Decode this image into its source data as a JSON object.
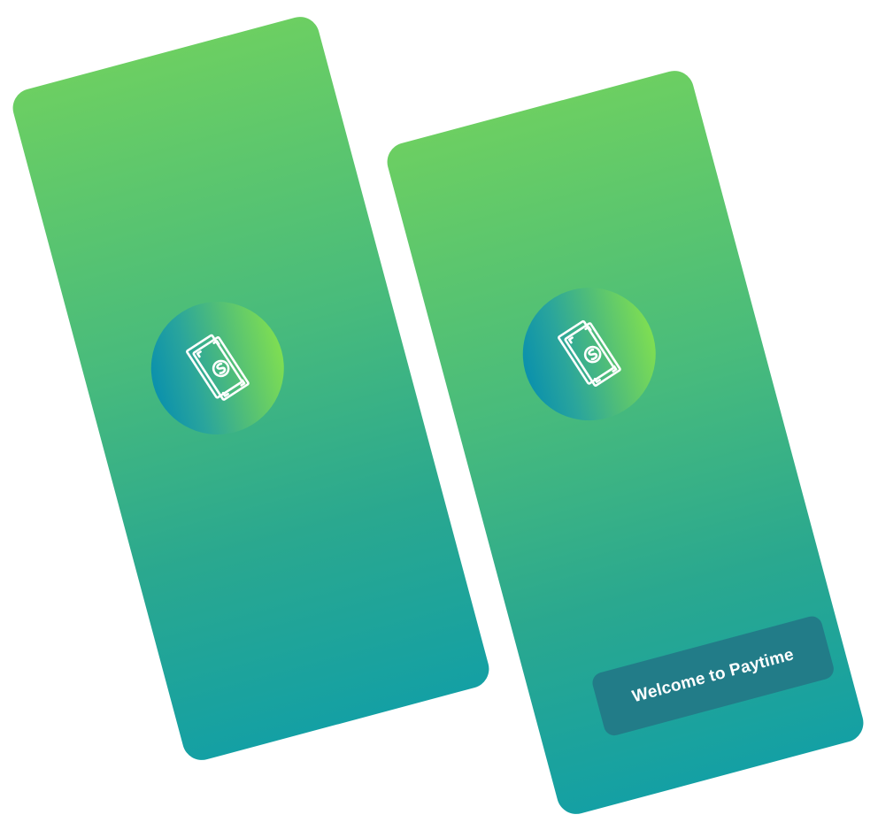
{
  "screens": [
    {
      "id": "splash-left",
      "logo": {
        "icon": "money-bills-icon"
      }
    },
    {
      "id": "splash-right",
      "logo": {
        "icon": "money-bills-icon"
      },
      "welcome_button": {
        "label": "Welcome to Paytime"
      }
    }
  ],
  "colors": {
    "gradient_top": "#6ccf62",
    "gradient_bottom": "#14a0a4",
    "logo_left": "#0b91ac",
    "logo_right": "#7fde52",
    "button_bg": "#227c88",
    "button_text": "#ffffff"
  }
}
